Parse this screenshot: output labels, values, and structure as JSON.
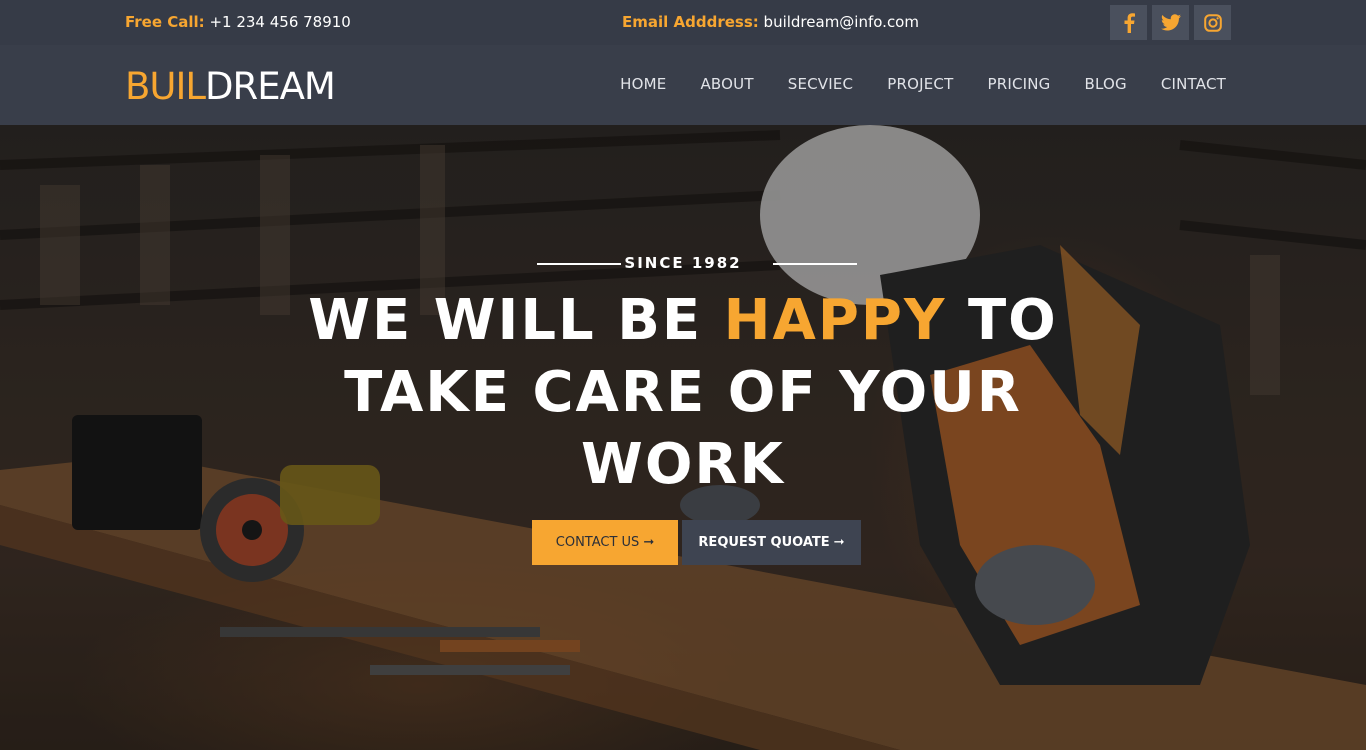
{
  "topbar": {
    "call_label": "Free Call:",
    "call_value": "+1 234 456 78910",
    "email_label": "Email Adddress:",
    "email_value": "buildream@info.com",
    "social": [
      {
        "icon": "facebook-icon"
      },
      {
        "icon": "twitter-icon"
      },
      {
        "icon": "instagram-icon"
      }
    ]
  },
  "logo": {
    "part1": "BUIL",
    "part2": "DREAM"
  },
  "nav": {
    "items": [
      {
        "label": "HOME"
      },
      {
        "label": "ABOUT"
      },
      {
        "label": "SECVIEC"
      },
      {
        "label": "PROJECT"
      },
      {
        "label": "PRICING"
      },
      {
        "label": "BLOG"
      },
      {
        "label": "CINTACT"
      }
    ]
  },
  "hero": {
    "since": "SINCE 1982",
    "headline_pre": "WE WILL BE ",
    "headline_accent": "HAPPY",
    "headline_post": " TO TAKE CARE OF YOUR WORK",
    "contact_button": "CONTACT US",
    "quote_button": "REQUEST QUOATE",
    "arrow": "➞"
  },
  "colors": {
    "accent": "#f7a631",
    "topbar_bg": "#363b47",
    "navbar_bg": "#393e4a",
    "dark_button": "#3e4451"
  }
}
